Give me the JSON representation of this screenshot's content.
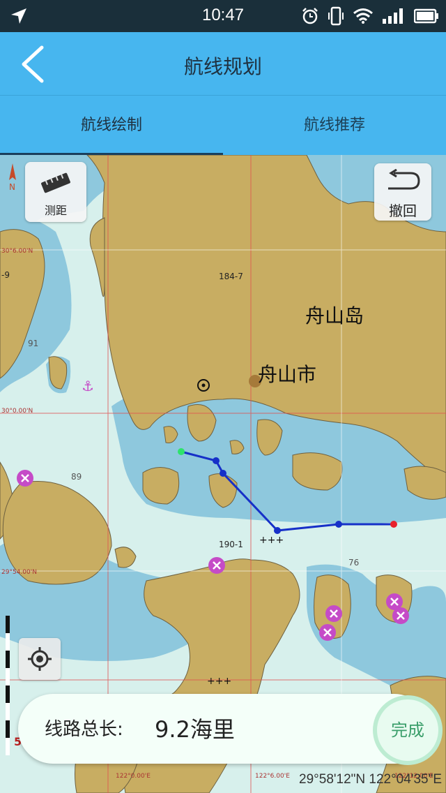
{
  "status": {
    "time": "10:47"
  },
  "header": {
    "title": "航线规划",
    "back_icon": "chevron-left-icon"
  },
  "tabs": [
    {
      "label": "航线绘制",
      "active": true
    },
    {
      "label": "航线推荐",
      "active": false
    }
  ],
  "map": {
    "measure_label": "测距",
    "undo_label": "撤回",
    "place_labels": {
      "island": "舟山岛",
      "city": "舟山市"
    },
    "chart_labels": [
      "184-7",
      "91",
      "89",
      "190-1",
      "76",
      "-9"
    ],
    "lat_labels": [
      "30°6.00'N",
      "30°0.00'N",
      "29°54.00'N"
    ],
    "lon_labels": [
      "122°0.00'E",
      "122°6.00'E",
      "122°12.00'E"
    ],
    "scale_label": "5"
  },
  "route": {
    "total_label": "线路总长:",
    "total_value": "9.2海里",
    "done_label": "完成"
  },
  "location": {
    "readout": "29°58'12\"N 122°04'35\"E"
  },
  "colors": {
    "land": "#c8ad62",
    "shallow": "#8ec8dd",
    "deep": "#d7f0ec",
    "appbar": "#47b6ef",
    "route": "#1630c8",
    "start": "#2ee36b",
    "end": "#e8212b"
  }
}
